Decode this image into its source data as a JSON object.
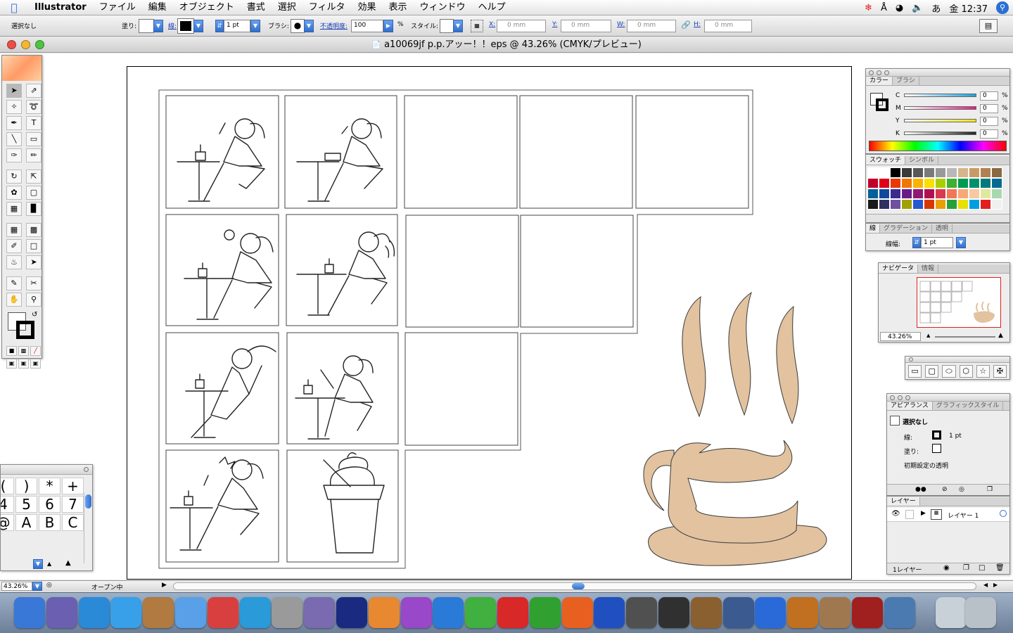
{
  "menubar": {
    "app": "Illustrator",
    "items": [
      "ファイル",
      "編集",
      "オブジェクト",
      "書式",
      "選択",
      "フィルタ",
      "効果",
      "表示",
      "ウィンドウ",
      "ヘルプ"
    ],
    "clock": "金 12:37",
    "input_mode": "あ"
  },
  "controlbar": {
    "selection": "選択なし",
    "fill_label": "塗り:",
    "stroke_label": "線:",
    "stroke_weight": "1 pt",
    "brush_label": "ブラシ:",
    "opacity_label": "不透明度:",
    "opacity_value": "100",
    "opacity_unit": "%",
    "style_label": "スタイル:",
    "x_label": "X:",
    "x_value": "0 mm",
    "y_label": "Y:",
    "y_value": "0 mm",
    "w_label": "W:",
    "w_value": "0 mm",
    "h_label": "H:",
    "h_value": "0 mm"
  },
  "document": {
    "title": "a10069jf p.p.アッー！！eps @ 43.26% (CMYK/プレビュー)"
  },
  "color_palette": {
    "tabs": [
      "カラー",
      "ブラシ"
    ],
    "channels": [
      {
        "name": "C",
        "value": "0",
        "unit": "%",
        "color": "#1fa0e0"
      },
      {
        "name": "M",
        "value": "0",
        "unit": "%",
        "color": "#e0208a"
      },
      {
        "name": "Y",
        "value": "0",
        "unit": "%",
        "color": "#f2e21a"
      },
      {
        "name": "K",
        "value": "0",
        "unit": "%",
        "color": "#222222"
      }
    ]
  },
  "swatches_palette": {
    "tabs": [
      "スウォッチ",
      "シンボル"
    ],
    "colors": [
      "#ffffff",
      "#ffffff",
      "#000000",
      "#3a3a3a",
      "#585858",
      "#7a7a7a",
      "#999999",
      "#b8b8b8",
      "#d6b48c",
      "#c89b64",
      "#b08050",
      "#8a6840",
      "#c0002a",
      "#e00018",
      "#e83a00",
      "#f07800",
      "#f8b400",
      "#f8e000",
      "#a8d000",
      "#40b030",
      "#009a50",
      "#00906c",
      "#007a7a",
      "#006a90",
      "#00609a",
      "#1048a0",
      "#3a2a90",
      "#6a1a88",
      "#901a70",
      "#b01050",
      "#d83a50",
      "#f07858",
      "#f8a878",
      "#f8c8a0",
      "#e0e8a0",
      "#a8d8b0",
      "#1a1a1a",
      "#303060",
      "#7050a0",
      "#a0a000",
      "#2858d0",
      "#d83800",
      "#e8a000",
      "#28a038",
      "#e8e000",
      "#00a0e0",
      "#e02020",
      "#f0f0f0"
    ]
  },
  "stroke_palette": {
    "tabs": [
      "線",
      "グラデーション",
      "透明"
    ],
    "weight_label": "線幅:",
    "weight_value": "1 pt"
  },
  "navigator_palette": {
    "tabs": [
      "ナビゲータ",
      "情報"
    ],
    "zoom": "43.26%"
  },
  "appearance_palette": {
    "tabs": [
      "アピアランス",
      "グラフィックスタイル"
    ],
    "selection": "選択なし",
    "stroke_label": "線:",
    "stroke_value": "1 pt",
    "fill_label": "塗り:",
    "opacity_label": "初期設定の透明"
  },
  "layers_palette": {
    "tabs": [
      "レイヤー"
    ],
    "layer_name": "レイヤー 1",
    "count": "1レイヤー"
  },
  "keyboard_palette": {
    "keys": [
      "(",
      ")",
      "*",
      "+",
      "4",
      "5",
      "6",
      "7",
      "@",
      "A",
      "B",
      "C"
    ]
  },
  "statusbar": {
    "zoom": "43.26%",
    "status": "オープン中"
  },
  "artwork": {
    "coffee_color": "#e2c29f"
  },
  "dock": {
    "icons": [
      "finder-icon",
      "mail-icon",
      "safari-icon",
      "ichat-icon",
      "address-book-icon",
      "itunes-icon",
      "ical-icon",
      "quicktime-icon",
      "system-preferences-icon",
      "mail-alt-icon",
      "star-icon",
      "illustrator-icon",
      "photoshop-icon",
      "fireworks-icon",
      "dreamweaver-icon",
      "flash-icon",
      "contribute-icon",
      "freehand-icon",
      "word-icon",
      "cube-icon",
      "dashboard-icon",
      "iphoto-icon",
      "aperture-icon",
      "dvd-icon",
      "garageband-icon",
      "preview-icon",
      "photo-booth-icon",
      "iphoto-alt-icon",
      "mail-app-icon",
      "trash-icon"
    ]
  }
}
